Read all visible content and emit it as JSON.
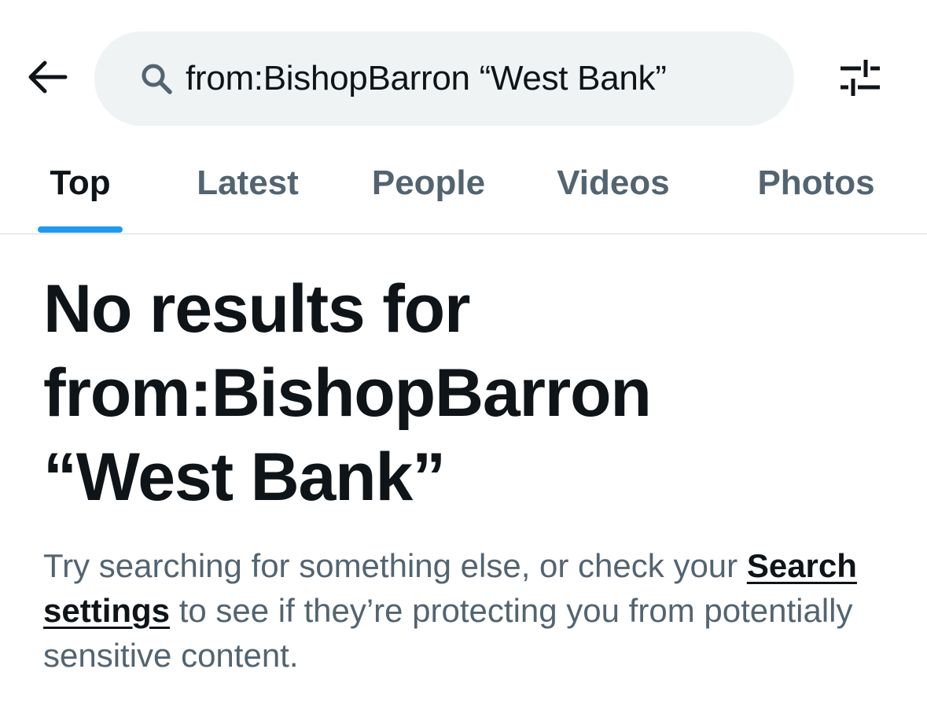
{
  "header": {
    "back_icon": "arrow-left-icon",
    "search_icon": "search-icon",
    "search_query": "from:BishopBarron “West Bank”",
    "filter_icon": "sliders-icon"
  },
  "tabs": [
    {
      "label": "Top",
      "active": true
    },
    {
      "label": "Latest",
      "active": false
    },
    {
      "label": "People",
      "active": false
    },
    {
      "label": "Videos",
      "active": false
    },
    {
      "label": "Photos",
      "active": false
    }
  ],
  "empty_state": {
    "title": "No results for from:BishopBarron “West Bank”",
    "body_before": "Try searching for something else, or check your ",
    "settings_link": "Search settings",
    "body_after": " to see if they’re protecting you from potentially sensitive content."
  },
  "colors": {
    "accent": "#1d9bf0",
    "text_primary": "#0f1419",
    "text_secondary": "#536471",
    "search_bg": "#eff3f4",
    "divider": "#cfd9de"
  }
}
